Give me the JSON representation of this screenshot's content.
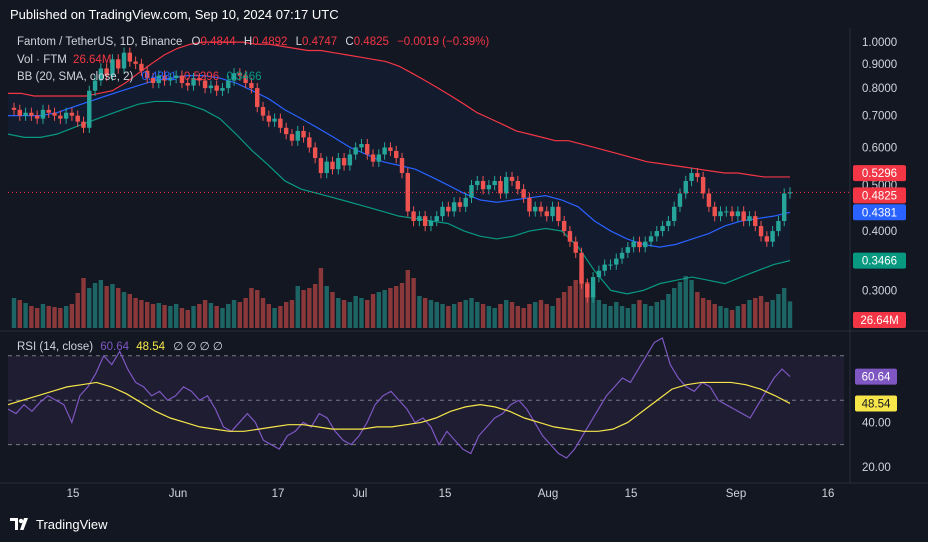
{
  "header": {
    "published": "Published on TradingView.com, Sep 10, 2024 07:17 UTC"
  },
  "legend": {
    "symbol": "Fantom / TetherUS, 1D, Binance",
    "o_label": "O",
    "o": "0.4844",
    "h_label": "H",
    "h": "0.4892",
    "l_label": "L",
    "l": "0.4747",
    "c_label": "C",
    "c": "0.4825",
    "change": "−0.0019 (−0.39%)",
    "vol_label": "Vol · FTM",
    "vol": "26.64M",
    "bb_label": "BB (20, SMA, close, 2)",
    "bb_basis": "0.4381",
    "bb_upper": "0.5296",
    "bb_lower": "0.3466",
    "rsi_label": "RSI (14, close)",
    "rsi": "60.64",
    "rsi_ma": "48.54",
    "rsi_extra": "∅ ∅ ∅ ∅"
  },
  "brand": {
    "name": "TradingView"
  },
  "colors": {
    "bg": "#131722",
    "up": "#26a69a",
    "down": "#ef5350",
    "basis": "#2962ff",
    "upper": "#f23645",
    "lower": "#089981",
    "rsi": "#7e57c2",
    "rsi_ma": "#f7e64a"
  },
  "chart_data": [
    {
      "type": "candlestick",
      "title": "Fantom / TetherUS, 1D, Binance",
      "y_axis": {
        "scale": "log",
        "ylim": [
          0.25,
          1.03
        ],
        "ticks": [
          "1.0000",
          "0.9000",
          "0.8000",
          "0.7000",
          "0.6000",
          "0.5000",
          "0.4000",
          "0.3000"
        ]
      },
      "x_axis": {
        "ticks": [
          "15",
          "Jun",
          "17",
          "Jul",
          "15",
          "Aug",
          "15",
          "Sep",
          "16"
        ]
      },
      "price_labels": {
        "bb_upper": "0.5296",
        "last": "0.4825",
        "bb_basis": "0.4381",
        "bb_lower": "0.3466",
        "volume": "26.64M"
      },
      "close": [
        0.72,
        0.7,
        0.71,
        0.7,
        0.69,
        0.72,
        0.71,
        0.7,
        0.69,
        0.71,
        0.7,
        0.68,
        0.66,
        0.79,
        0.83,
        0.88,
        0.85,
        0.92,
        0.88,
        0.95,
        0.91,
        0.9,
        0.87,
        0.84,
        0.82,
        0.85,
        0.83,
        0.84,
        0.85,
        0.82,
        0.81,
        0.84,
        0.83,
        0.8,
        0.81,
        0.79,
        0.8,
        0.83,
        0.86,
        0.85,
        0.82,
        0.8,
        0.73,
        0.7,
        0.68,
        0.69,
        0.66,
        0.64,
        0.62,
        0.65,
        0.63,
        0.6,
        0.57,
        0.53,
        0.56,
        0.54,
        0.57,
        0.55,
        0.58,
        0.6,
        0.61,
        0.58,
        0.56,
        0.58,
        0.6,
        0.59,
        0.57,
        0.53,
        0.44,
        0.42,
        0.43,
        0.41,
        0.42,
        0.43,
        0.45,
        0.44,
        0.46,
        0.45,
        0.47,
        0.5,
        0.51,
        0.49,
        0.5,
        0.51,
        0.48,
        0.52,
        0.51,
        0.49,
        0.47,
        0.44,
        0.45,
        0.44,
        0.43,
        0.45,
        0.42,
        0.4,
        0.38,
        0.36,
        0.31,
        0.29,
        0.32,
        0.33,
        0.34,
        0.34,
        0.35,
        0.36,
        0.37,
        0.38,
        0.37,
        0.38,
        0.39,
        0.4,
        0.41,
        0.42,
        0.45,
        0.48,
        0.51,
        0.53,
        0.52,
        0.48,
        0.45,
        0.43,
        0.44,
        0.44,
        0.43,
        0.44,
        0.42,
        0.43,
        0.41,
        0.39,
        0.38,
        0.4,
        0.42,
        0.48,
        0.4825
      ],
      "volume_m": [
        30,
        28,
        25,
        22,
        20,
        24,
        22,
        21,
        20,
        22,
        24,
        35,
        50,
        40,
        45,
        48,
        42,
        44,
        40,
        36,
        34,
        30,
        28,
        26,
        24,
        25,
        23,
        22,
        24,
        20,
        18,
        22,
        24,
        28,
        25,
        22,
        20,
        24,
        28,
        26,
        30,
        40,
        38,
        30,
        24,
        20,
        22,
        26,
        28,
        42,
        38,
        40,
        44,
        60,
        42,
        36,
        30,
        28,
        26,
        32,
        30,
        28,
        34,
        36,
        38,
        40,
        42,
        45,
        58,
        50,
        32,
        30,
        28,
        26,
        24,
        22,
        24,
        26,
        28,
        30,
        26,
        24,
        22,
        20,
        24,
        28,
        26,
        22,
        20,
        24,
        26,
        28,
        24,
        22,
        30,
        36,
        42,
        48,
        56,
        46,
        32,
        28,
        24,
        22,
        26,
        22,
        20,
        24,
        28,
        24,
        22,
        26,
        28,
        34,
        40,
        46,
        52,
        48,
        36,
        30,
        28,
        24,
        22,
        20,
        18,
        22,
        24,
        28,
        30,
        32,
        26,
        28,
        34,
        40,
        26.64
      ],
      "bb_upper": [
        0.78,
        0.78,
        0.77,
        0.77,
        0.77,
        0.77,
        0.77,
        0.78,
        0.79,
        0.82,
        0.86,
        0.9,
        0.94,
        0.97,
        0.99,
        1.0,
        1.0,
        1.0,
        1.0,
        0.99,
        0.99,
        0.98,
        0.97,
        0.96,
        0.96,
        0.95,
        0.94,
        0.93,
        0.92,
        0.91,
        0.89,
        0.86,
        0.83,
        0.8,
        0.77,
        0.74,
        0.71,
        0.69,
        0.67,
        0.65,
        0.64,
        0.63,
        0.62,
        0.62,
        0.61,
        0.6,
        0.59,
        0.58,
        0.57,
        0.56,
        0.555,
        0.55,
        0.545,
        0.54,
        0.535,
        0.53,
        0.53,
        0.525,
        0.52,
        0.52,
        0.52
      ],
      "bb_basis": [
        0.7,
        0.7,
        0.7,
        0.71,
        0.73,
        0.75,
        0.77,
        0.79,
        0.81,
        0.83,
        0.84,
        0.85,
        0.85,
        0.84,
        0.82,
        0.79,
        0.76,
        0.72,
        0.69,
        0.66,
        0.63,
        0.6,
        0.58,
        0.56,
        0.55,
        0.54,
        0.52,
        0.5,
        0.48,
        0.465,
        0.46,
        0.465,
        0.47,
        0.475,
        0.465,
        0.45,
        0.42,
        0.4,
        0.385,
        0.375,
        0.37,
        0.375,
        0.385,
        0.395,
        0.41,
        0.42,
        0.425,
        0.43,
        0.4381
      ],
      "bb_lower": [
        0.64,
        0.63,
        0.63,
        0.64,
        0.66,
        0.68,
        0.7,
        0.72,
        0.74,
        0.75,
        0.75,
        0.74,
        0.72,
        0.69,
        0.64,
        0.59,
        0.55,
        0.51,
        0.49,
        0.48,
        0.47,
        0.46,
        0.45,
        0.44,
        0.43,
        0.425,
        0.42,
        0.415,
        0.4,
        0.39,
        0.385,
        0.39,
        0.4,
        0.405,
        0.4,
        0.37,
        0.33,
        0.3,
        0.295,
        0.3,
        0.31,
        0.315,
        0.32,
        0.315,
        0.31,
        0.32,
        0.33,
        0.34,
        0.3466
      ]
    },
    {
      "type": "line",
      "title": "RSI (14, close)",
      "y_axis": {
        "ticks": [
          "60.64",
          "48.54",
          "40.00",
          "20.00"
        ],
        "ylim": [
          15,
          78
        ],
        "bands": [
          30,
          50,
          70
        ]
      },
      "series": [
        {
          "name": "RSI",
          "values": [
            46,
            44,
            48,
            45,
            49,
            52,
            50,
            48,
            40,
            52,
            56,
            62,
            70,
            66,
            72,
            64,
            58,
            56,
            52,
            54,
            50,
            52,
            56,
            54,
            50,
            52,
            46,
            38,
            36,
            40,
            44,
            40,
            32,
            30,
            28,
            34,
            36,
            40,
            38,
            44,
            42,
            36,
            32,
            30,
            34,
            40,
            48,
            52,
            54,
            50,
            46,
            40,
            42,
            38,
            30,
            36,
            32,
            28,
            26,
            34,
            38,
            42,
            44,
            48,
            50,
            46,
            40,
            34,
            30,
            26,
            24,
            28,
            34,
            40,
            46,
            52,
            56,
            60,
            58,
            64,
            70,
            76,
            78,
            66,
            60,
            56,
            54,
            58,
            56,
            50,
            48,
            46,
            44,
            42,
            48,
            54,
            60,
            64,
            60.64
          ]
        },
        {
          "name": "RSI MA",
          "values": [
            48,
            50,
            52,
            54,
            56,
            57,
            58,
            56,
            53,
            49,
            45,
            42,
            40,
            38,
            37,
            36,
            36,
            37,
            38,
            39,
            39,
            38,
            37,
            37,
            37,
            38,
            38,
            39,
            40,
            42,
            45,
            47,
            48,
            47,
            45,
            42,
            40,
            38,
            37,
            36,
            36,
            37,
            40,
            45,
            50,
            55,
            57,
            58,
            58,
            58,
            57,
            55,
            52,
            48.54
          ]
        }
      ]
    }
  ]
}
